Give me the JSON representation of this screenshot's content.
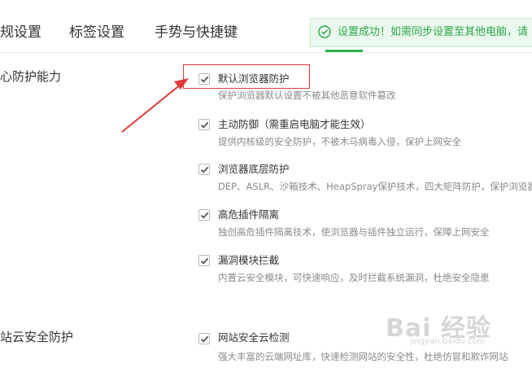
{
  "tabs": [
    {
      "label": "规设置"
    },
    {
      "label": "标签设置"
    },
    {
      "label": "手势与快捷键"
    }
  ],
  "toast": {
    "text": "设置成功！如需同步设置至其他电脑，请",
    "icon": "check-circle-icon"
  },
  "sections": [
    {
      "title": "心防护能力",
      "options": [
        {
          "label": "默认浏览器防护",
          "desc": "保护浏览器默认设置不被其他恶意软件篡改",
          "checked": true
        },
        {
          "label": "主动防御（需重启电脑才能生效）",
          "desc": "提供内核级的安全防护，不被木马病毒入侵，保护上网安全",
          "checked": true
        },
        {
          "label": "浏览器底层防护",
          "desc": "DEP、ASLR、沙箱技术、HeapSpray保护技术，四大矩阵防护，保护浏览器",
          "checked": true
        },
        {
          "label": "高危插件隔离",
          "desc": "独创高危插件隔离技术，使浏览器与插件独立运行，保障上网安全",
          "checked": true
        },
        {
          "label": "漏洞模块拦截",
          "desc": "内置云安全模块，可快速响应，及时拦截系统漏洞，杜绝安全隐患",
          "checked": true
        }
      ]
    },
    {
      "title": "站云安全防护",
      "options": [
        {
          "label": "网站安全云检测",
          "desc": "强大丰富的云端网址库，快速检测网站的安全性，杜绝仿冒和欺诈网站",
          "checked": true
        }
      ]
    }
  ],
  "watermark": {
    "text": "Bai 经验",
    "sub": "jingyan.baidu.com"
  },
  "colors": {
    "accent": "#2fb24a",
    "highlight": "#e23b3b",
    "toast_bg": "#eaf8ee"
  }
}
